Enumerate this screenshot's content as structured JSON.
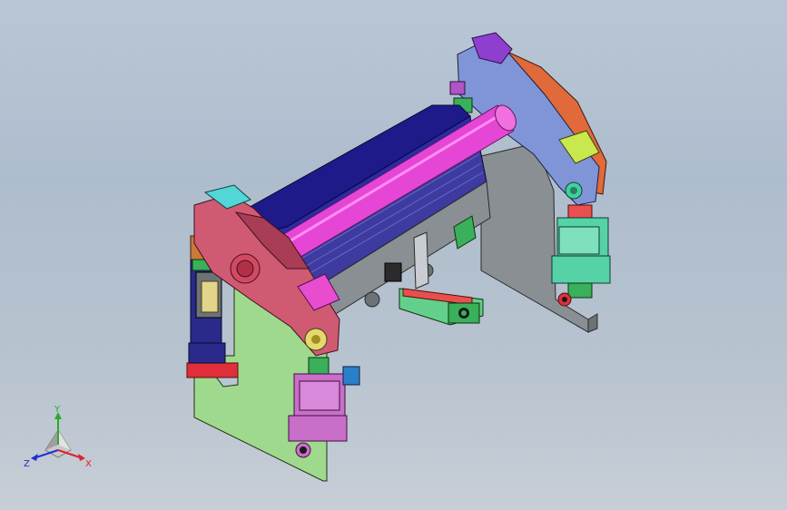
{
  "viewport": {
    "background_top": "#b9c6d6",
    "background_bottom": "#c7ced6"
  },
  "model": {
    "colors": {
      "left_side_plate": "#9fd98e",
      "right_side_plate": "#8a8f93",
      "left_arm": "#cf5a72",
      "right_arm": "#7f95d8",
      "right_arm_back": "#e06a3a",
      "top_block_left": "#52d6d6",
      "top_block_right": "#8e3fd0",
      "lever_block": "#e84dd0",
      "arm_pad_right": "#c8e84d",
      "main_roller": "#e646d6",
      "upper_beam": "#1f1a8a",
      "roller_body": "#3d3aa0",
      "teal_strip": "#5ed3b6",
      "left_cylinder": "#c96ec9",
      "right_cylinder": "#55d2a6",
      "small_green": "#39b05a",
      "small_blue": "#2a80c8",
      "small_red": "#e02f3b"
    }
  },
  "triad": {
    "x_label": "X",
    "y_label": "Y",
    "z_label": "Z",
    "x_color": "#e0202a",
    "y_color": "#2caa2c",
    "z_color": "#2030d0"
  }
}
